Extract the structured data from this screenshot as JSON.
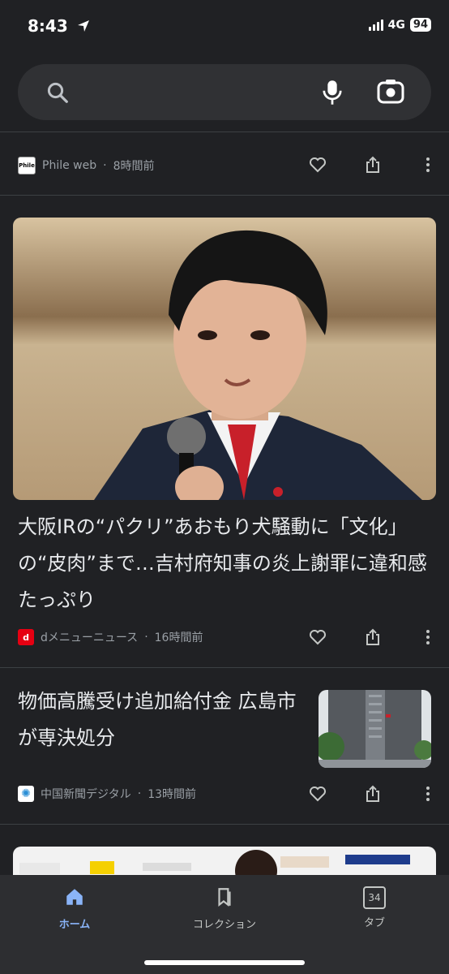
{
  "status": {
    "time": "8:43",
    "network": "4G",
    "battery": "94"
  },
  "search": {
    "placeholder": ""
  },
  "cards": [
    {
      "source": "Phile web",
      "time": "8時間前",
      "favicon_text": "Phile",
      "favicon_color": "#ffffff"
    },
    {
      "headline": "大阪IRの“パクリ”あおもり犬騒動に「文化」の“皮肉”まで…吉村府知事の炎上謝罪に違和感たっぷり",
      "source": "dメニューニュース",
      "time": "16時間前",
      "favicon_text": "d",
      "favicon_color": "#e60012"
    },
    {
      "headline": "物価高騰受け追加給付金 広島市が専決処分",
      "source": "中国新聞デジタル",
      "time": "13時間前",
      "favicon_text": "✺",
      "favicon_color": "#ffffff"
    }
  ],
  "nav": {
    "home": "ホーム",
    "collections": "コレクション",
    "tabs": "タブ",
    "tab_count": "34"
  },
  "colors": {
    "accent": "#8ab4f8",
    "background": "#202124"
  }
}
